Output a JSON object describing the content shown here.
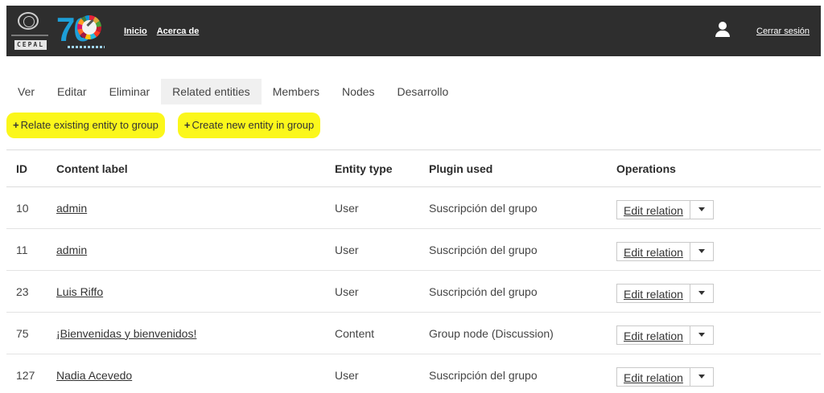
{
  "header": {
    "logo_un_text": "CEPAL",
    "logo_70_text": "70",
    "nav": [
      {
        "label": "Inicio"
      },
      {
        "label": "Acerca de"
      }
    ],
    "logout_label": "Cerrar sesión",
    "user_icon": "user-icon"
  },
  "tabs": [
    {
      "label": "Ver",
      "active": false
    },
    {
      "label": "Editar",
      "active": false
    },
    {
      "label": "Eliminar",
      "active": false
    },
    {
      "label": "Related entities",
      "active": true
    },
    {
      "label": "Members",
      "active": false
    },
    {
      "label": "Nodes",
      "active": false
    },
    {
      "label": "Desarrollo",
      "active": false
    }
  ],
  "actions": [
    {
      "plus": "+",
      "label": "Relate existing entity to group"
    },
    {
      "plus": "+",
      "label": "Create new entity in group"
    }
  ],
  "table": {
    "headers": [
      "ID",
      "Content label",
      "Entity type",
      "Plugin used",
      "Operations"
    ],
    "rows": [
      {
        "id": "10",
        "label": "admin",
        "type": "User",
        "plugin": "Suscripción del grupo",
        "op": "Edit relation"
      },
      {
        "id": "11",
        "label": "admin",
        "type": "User",
        "plugin": "Suscripción del grupo",
        "op": "Edit relation"
      },
      {
        "id": "23",
        "label": "Luis Riffo",
        "type": "User",
        "plugin": "Suscripción del grupo",
        "op": "Edit relation"
      },
      {
        "id": "75",
        "label": "¡Bienvenidas y bienvenidos!",
        "type": "Content",
        "plugin": "Group node (Discussion)",
        "op": "Edit relation"
      },
      {
        "id": "127",
        "label": "Nadia Acevedo",
        "type": "User",
        "plugin": "Suscripción del grupo",
        "op": "Edit relation"
      }
    ]
  },
  "colors": {
    "header_bg": "#2e2e2e",
    "highlight": "#fbf71b",
    "active_tab_bg": "#f0f0f0"
  }
}
